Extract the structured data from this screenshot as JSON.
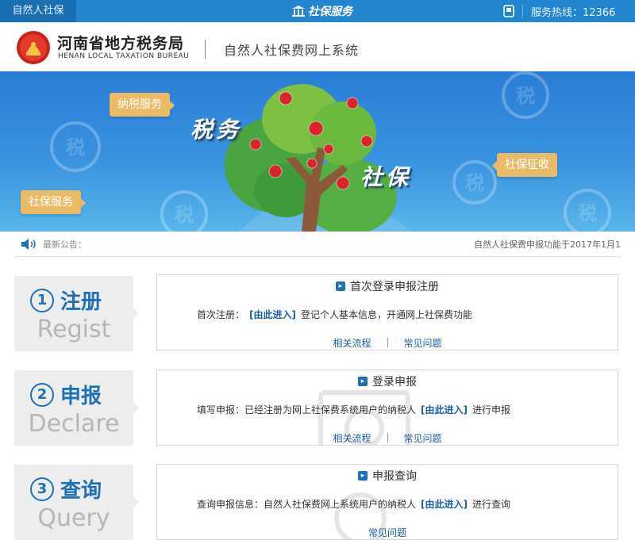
{
  "topbar": {
    "left_tab": "自然人社保",
    "brand": "社保服务",
    "hotline_label": "服务热线：12366"
  },
  "header": {
    "org_name_cn": "河南省地方税务局",
    "org_name_en": "HENAN LOCAL TAXATION BUREAU",
    "system_name": "自然人社保费网上系统"
  },
  "banner": {
    "bubble_tax_service": "纳税服务",
    "bubble_social_service": "社保服务",
    "bubble_social_collection": "社保征收",
    "text_tax": "税务",
    "text_social": "社保",
    "badge_char": "税"
  },
  "notice": {
    "label": "最新公告：",
    "text": "自然人社保费申报功能于2017年1月1"
  },
  "steps": [
    {
      "num": "1",
      "name_cn": "注册",
      "name_en": "Regist",
      "card_title": "首次登录申报注册",
      "desc_prefix": "首次注册：",
      "link": "[由此进入]",
      "desc_suffix": "登记个人基本信息，开通网上社保费功能",
      "sub_link_1": "相关流程",
      "sub_link_2": "常见问题"
    },
    {
      "num": "2",
      "name_cn": "申报",
      "name_en": "Declare",
      "card_title": "登录申报",
      "desc_prefix": "填写申报：已经注册为网上社保费系统用户的纳税人",
      "link": "[由此进入]",
      "desc_suffix": "进行申报",
      "sub_link_1": "相关流程",
      "sub_link_2": "常见问题"
    },
    {
      "num": "3",
      "name_cn": "查询",
      "name_en": "Query",
      "card_title": "申报查询",
      "desc_prefix": "查询申报信息：自然人社保费网上系统用户的纳税人",
      "link": "[由此进入]",
      "desc_suffix": "进行查询",
      "sub_link_1": "常见问题"
    }
  ],
  "colors": {
    "topbar": "#2385cf",
    "accent_blue": "#1d71b8",
    "bubble": "#e9bb67",
    "tile_bg": "#ededed"
  }
}
